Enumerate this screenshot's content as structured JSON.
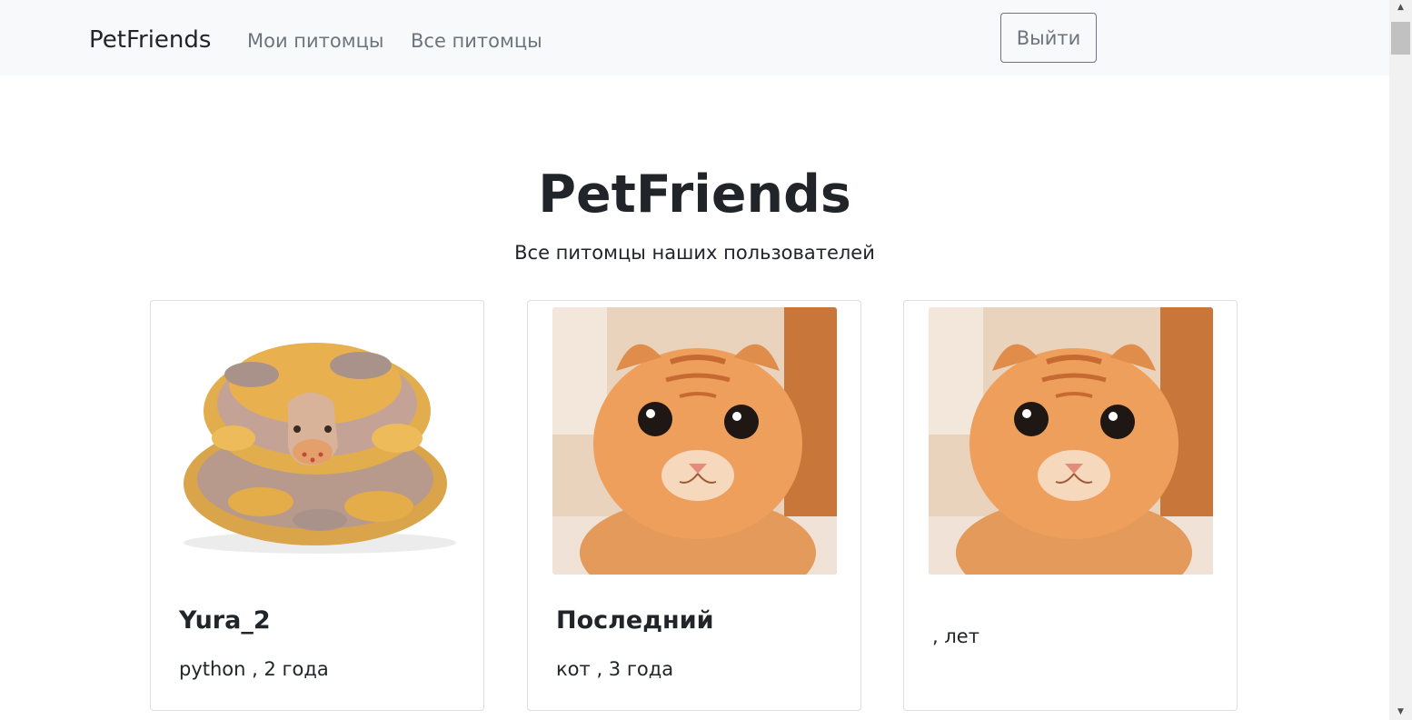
{
  "navbar": {
    "brand": "PetFriends",
    "links": [
      "Мои питомцы",
      "Все питомцы"
    ],
    "logout_label": "Выйти"
  },
  "header": {
    "title": "PetFriends",
    "subtitle": "Все питомцы наших пользователей"
  },
  "cards": [
    {
      "name": "Yura_2",
      "info": "python , 2 года",
      "image": "snake-photo"
    },
    {
      "name": "Последний",
      "info": "кот , 3 года",
      "image": "cat-photo"
    },
    {
      "name": "",
      "info": ", лет",
      "image": "cat-photo"
    }
  ],
  "colors": {
    "navbar_bg": "#f8f9fa",
    "text": "#212529",
    "muted": "#6c757d"
  }
}
